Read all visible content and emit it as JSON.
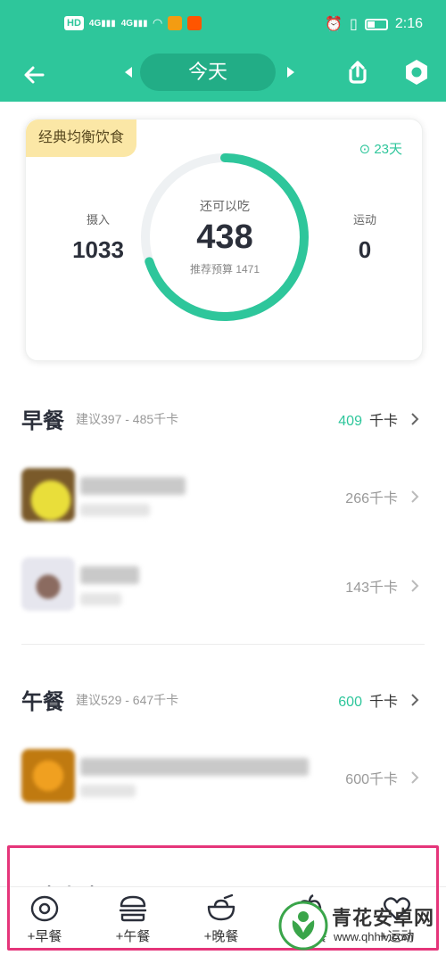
{
  "status_bar": {
    "network_badge": "HD",
    "signal_1": "4G",
    "signal_2": "4G",
    "time": "2:16"
  },
  "header": {
    "date_label": "今天"
  },
  "summary": {
    "plan_name": "经典均衡饮食",
    "streak": "23天",
    "intake_label": "摄入",
    "intake_value": "1033",
    "remaining_label": "还可以吃",
    "remaining_value": "438",
    "budget_text": "推荐预算 1471",
    "exercise_label": "运动",
    "exercise_value": "0",
    "progress": 0.7
  },
  "meals": [
    {
      "title": "早餐",
      "suggest": "建议397 - 485千卡",
      "kcal": "409",
      "unit": "千卡",
      "items": [
        {
          "kcal": "266千卡"
        },
        {
          "kcal": "143千卡"
        }
      ]
    },
    {
      "title": "午餐",
      "suggest": "建议529 - 647千卡",
      "kcal": "600",
      "unit": "千卡",
      "items": [
        {
          "kcal": "600千卡"
        }
      ]
    }
  ],
  "next_section_title": "三餐加餐",
  "bottom_tabs": [
    {
      "label": "+早餐",
      "icon": "egg-icon"
    },
    {
      "label": "+午餐",
      "icon": "burger-icon"
    },
    {
      "label": "+晚餐",
      "icon": "bowl-icon"
    },
    {
      "label": "+加餐",
      "icon": "apple-icon"
    },
    {
      "label": "+运动",
      "icon": "heart-icon"
    }
  ],
  "watermark": {
    "name": "青花安卓网",
    "url": "www.qhhlv.com"
  },
  "colors": {
    "brand": "#2ec69b",
    "highlight": "#e5357a",
    "tag_bg": "#fbe7a6"
  }
}
